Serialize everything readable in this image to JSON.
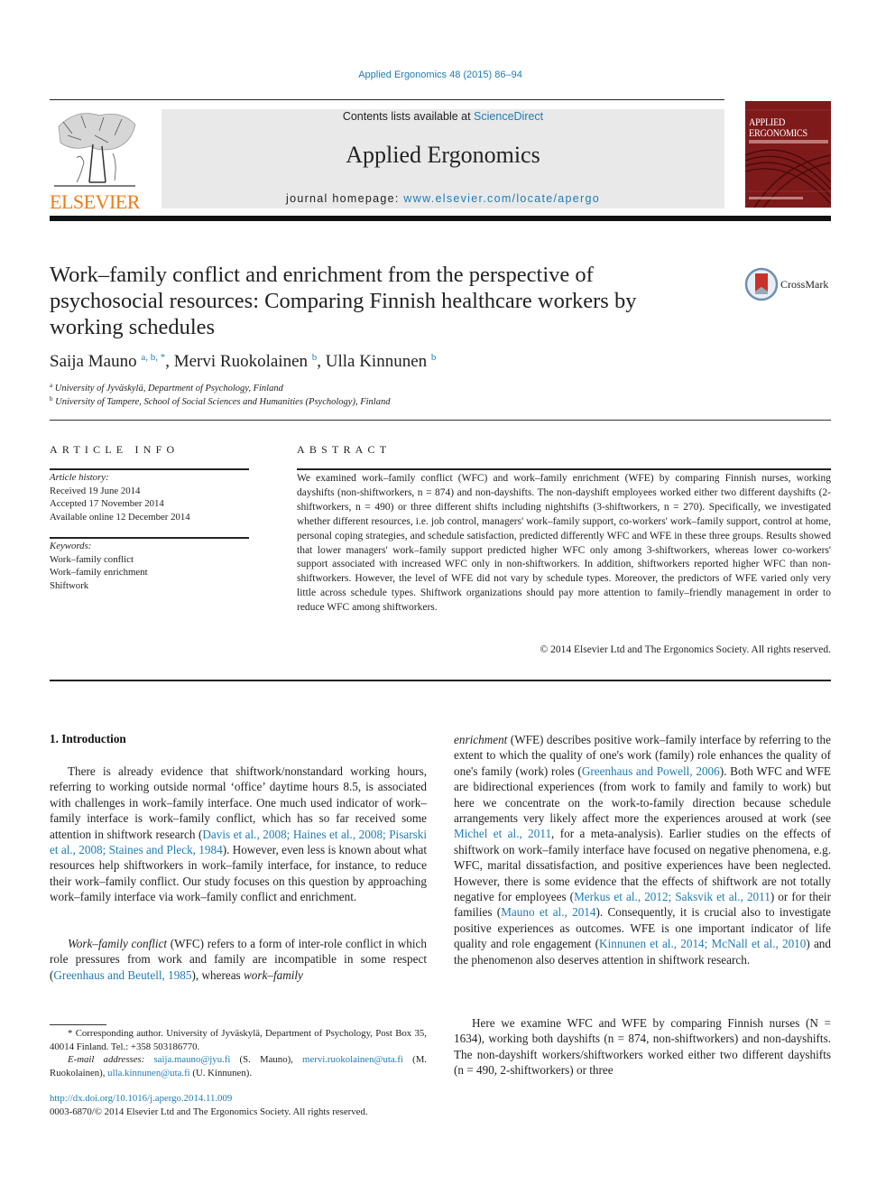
{
  "journal_citation": "Applied Ergonomics 48 (2015) 86–94",
  "header": {
    "publisher_wordmark": "ELSEVIER",
    "contents_prefix": "Contents lists available at ",
    "contents_link": "ScienceDirect",
    "journal_name": "Applied Ergonomics",
    "homepage_prefix": "journal homepage: ",
    "homepage_link": "www.elsevier.com/locate/apergo",
    "cover_title_line1": "APPLIED",
    "cover_title_line2": "ERGONOMICS"
  },
  "article": {
    "title": "Work–family conflict and enrichment from the perspective of psychosocial resources: Comparing Finnish healthcare workers by working schedules",
    "crossmark_label": "CrossMark",
    "authors": [
      {
        "name": "Saija Mauno",
        "sup": "a, b, *"
      },
      {
        "name": "Mervi Ruokolainen",
        "sup": "b"
      },
      {
        "name": "Ulla Kinnunen",
        "sup": "b"
      }
    ],
    "affiliations": [
      {
        "mark": "a",
        "text": "University of Jyväskylä, Department of Psychology, Finland"
      },
      {
        "mark": "b",
        "text": "University of Tampere, School of Social Sciences and Humanities (Psychology), Finland"
      }
    ]
  },
  "article_info": {
    "heading": "ARTICLE INFO",
    "history_label": "Article history:",
    "history": [
      "Received 19 June 2014",
      "Accepted 17 November 2014",
      "Available online 12 December 2014"
    ],
    "keywords_label": "Keywords:",
    "keywords": [
      "Work–family conflict",
      "Work–family enrichment",
      "Shiftwork"
    ]
  },
  "abstract": {
    "heading": "ABSTRACT",
    "text": "We examined work–family conflict (WFC) and work–family enrichment (WFE) by comparing Finnish nurses, working dayshifts (non-shiftworkers, n = 874) and non-dayshifts. The non-dayshift employees worked either two different dayshifts (2-shiftworkers, n = 490) or three different shifts including nightshifts (3-shiftworkers, n = 270). Specifically, we investigated whether different resources, i.e. job control, managers' work–family support, co-workers' work–family support, control at home, personal coping strategies, and schedule satisfaction, predicted differently WFC and WFE in these three groups. Results showed that lower managers' work–family support predicted higher WFC only among 3-shiftworkers, whereas lower co-workers' support associated with increased WFC only in non-shiftworkers. In addition, shiftworkers reported higher WFC than non-shiftworkers. However, the level of WFE did not vary by schedule types. Moreover, the predictors of WFE varied only very little across schedule types. Shiftwork organizations should pay more attention to family–friendly management in order to reduce WFC among shiftworkers.",
    "copyright": "© 2014 Elsevier Ltd and The Ergonomics Society. All rights reserved."
  },
  "body": {
    "section_heading": "1.  Introduction",
    "p1": {
      "text_a": "There is already evidence that shiftwork/nonstandard working hours, referring to working outside normal ‘office’ daytime hours 8.5, is associated with challenges in work–family interface. One much used indicator of work–family interface is work–family conflict, which has so far received some attention in shiftwork research (",
      "cite": "Davis et al., 2008; Haines et al., 2008; Pisarski et al., 2008; Staines and Pleck, 1984",
      "text_b": "). However, even less is known about what resources help shiftworkers in work–family interface, for instance, to reduce their work–family conflict. Our study focuses on this question by approaching work–family interface via work–family conflict and enrichment."
    },
    "p2": {
      "term": "Work–family conflict",
      "text_a": " (WFC) refers to a form of inter-role conflict in which role pressures from work and family are incompatible in some respect (",
      "cite": "Greenhaus and Beutell, 1985",
      "text_b": "), whereas ",
      "term2": "work–family"
    },
    "p3": {
      "term": "enrichment",
      "text_a": " (WFE) describes positive work–family interface by referring to the extent to which the quality of one's work (family) role enhances the quality of one's family (work) roles (",
      "cite1": "Greenhaus and Powell, 2006",
      "text_b": "). Both WFC and WFE are bidirectional experiences (from work to family and family to work) but here we concentrate on the work-to-family direction because schedule arrangements very likely affect more the experiences aroused at work (see ",
      "cite2": "Michel et al., 2011",
      "text_c": ", for a meta-analysis). Earlier studies on the effects of shiftwork on work–family interface have focused on negative phenomena, e.g. WFC, marital dissatisfaction, and positive experiences have been neglected. However, there is some evidence that the effects of shiftwork are not totally negative for employees (",
      "cite3": "Merkus et al., 2012; Saksvik et al., 2011",
      "text_d": ") or for their families (",
      "cite4": "Mauno et al., 2014",
      "text_e": "). Consequently, it is crucial also to investigate positive experiences as outcomes. WFE is one important indicator of life quality and role engagement (",
      "cite5": "Kinnunen et al., 2014; McNall et al., 2010",
      "text_f": ") and the phenomenon also deserves attention in shiftwork research."
    },
    "p4": {
      "text": "Here we examine WFC and WFE by comparing Finnish nurses (N = 1634), working both dayshifts (n = 874, non-shiftworkers) and non-dayshifts. The non-dayshift workers/shiftworkers worked either two different dayshifts (n = 490, 2-shiftworkers) or three"
    }
  },
  "footnotes": {
    "corresponding": "* Corresponding author. University of Jyväskylä, Department of Psychology, Post Box 35, 40014 Finland. Tel.: +358 503186770.",
    "email_label": "E-mail addresses:",
    "emails": [
      {
        "address": "saija.mauno@jyu.fi",
        "who": " (S. Mauno), "
      },
      {
        "address": "mervi.ruokolainen@uta.fi",
        "who": " (M. Ruokolainen), "
      },
      {
        "address": "ulla.kinnunen@uta.fi",
        "who": " (U. Kinnunen)."
      }
    ],
    "doi": "http://dx.doi.org/10.1016/j.apergo.2014.11.009",
    "issn": "0003-6870/© 2014 Elsevier Ltd and The Ergonomics Society. All rights reserved."
  }
}
